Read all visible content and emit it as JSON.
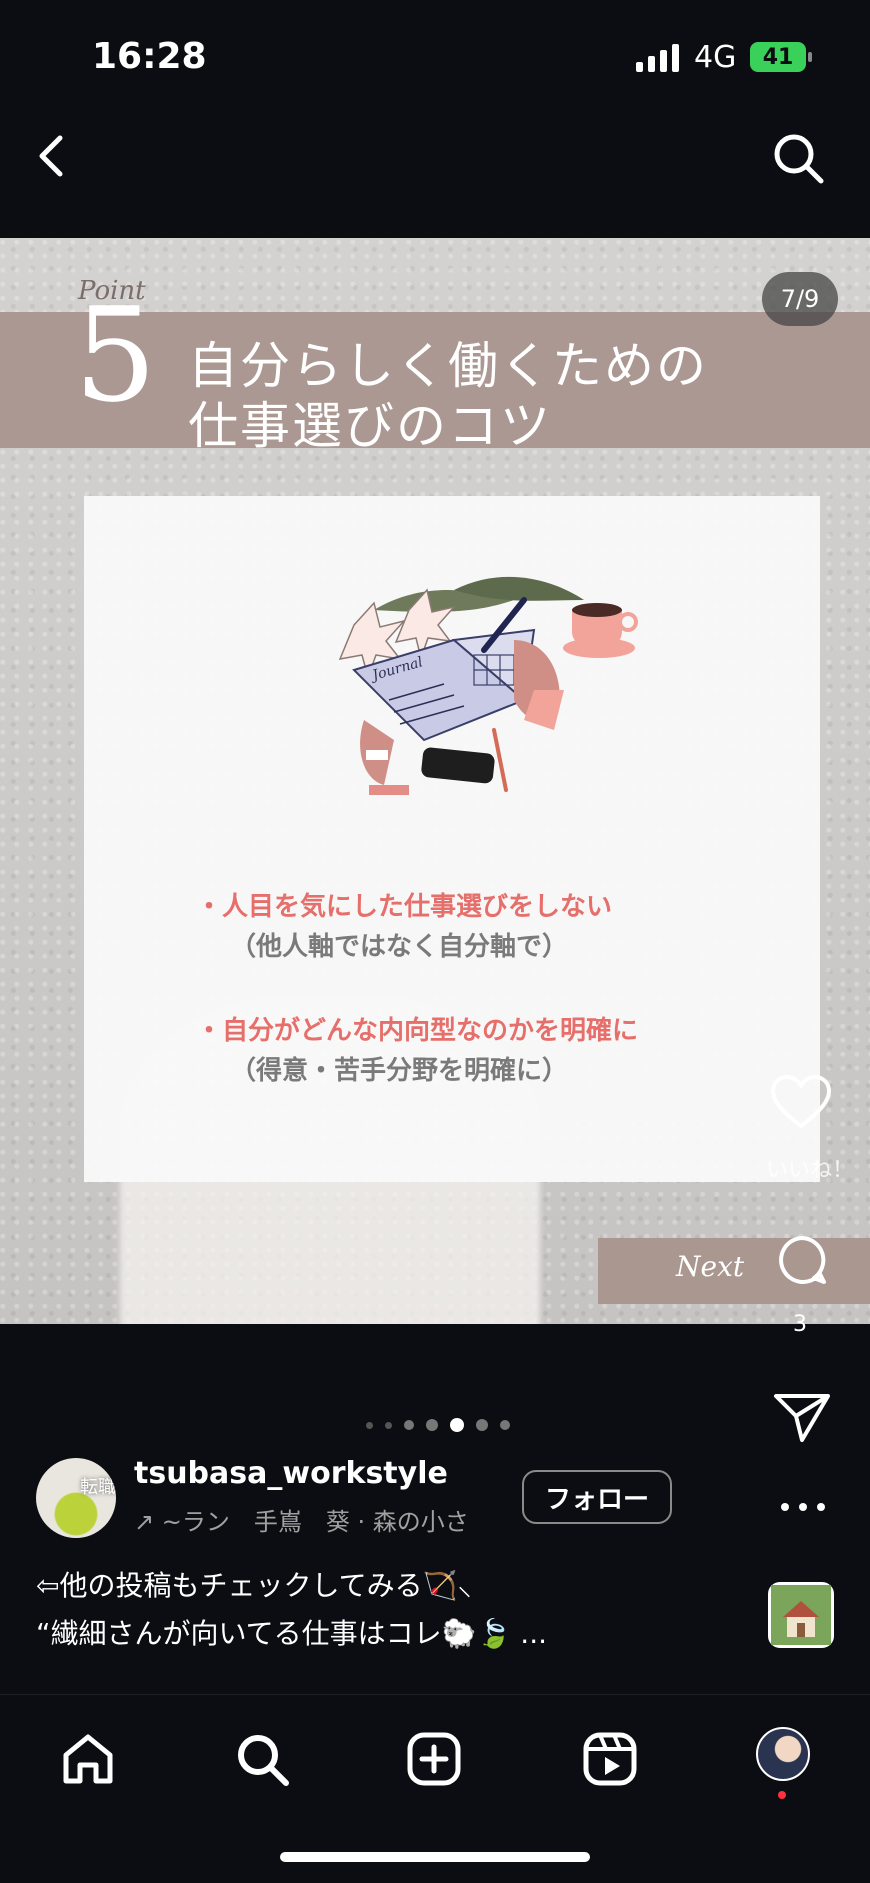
{
  "status": {
    "time": "16:28",
    "network": "4G",
    "battery": "41"
  },
  "post": {
    "point_label": "Point",
    "point_number": "5",
    "title_line1": "自分らしく働くための",
    "title_line2": "仕事選びのコツ",
    "page_counter": "7/9",
    "tips": [
      {
        "main": "・人目を気にした仕事選びをしない",
        "sub": "（他人軸ではなく自分軸で）"
      },
      {
        "main": "・自分がどんな内向型なのかを明確に",
        "sub": "（得意・苦手分野を明確に）"
      }
    ],
    "illustration_text": "Journal",
    "next_label": "Next"
  },
  "actions": {
    "like_count": "いいね！",
    "comment_count": "3"
  },
  "carousel": {
    "total": 7,
    "active_index": 4
  },
  "profile": {
    "avatar_text": "転職",
    "username": "tsubasa_workstyle",
    "audio": "↗ ~ラン　手嶌　葵 · 森の小さ",
    "follow_label": "フォロー"
  },
  "caption": {
    "line1": "⇦他の投稿もチェックしてみる🏹⸜",
    "line2": "“繊細さんが向いてる仕事はコレ🐑🍃 ..."
  },
  "nav": [
    "home-icon",
    "search-icon",
    "create-icon",
    "reels-icon",
    "profile"
  ],
  "colors": {
    "band": "#ab9892",
    "tip_accent": "#e66f6b",
    "tip_sub": "#7a7a7a",
    "background": "#0b0d12"
  }
}
